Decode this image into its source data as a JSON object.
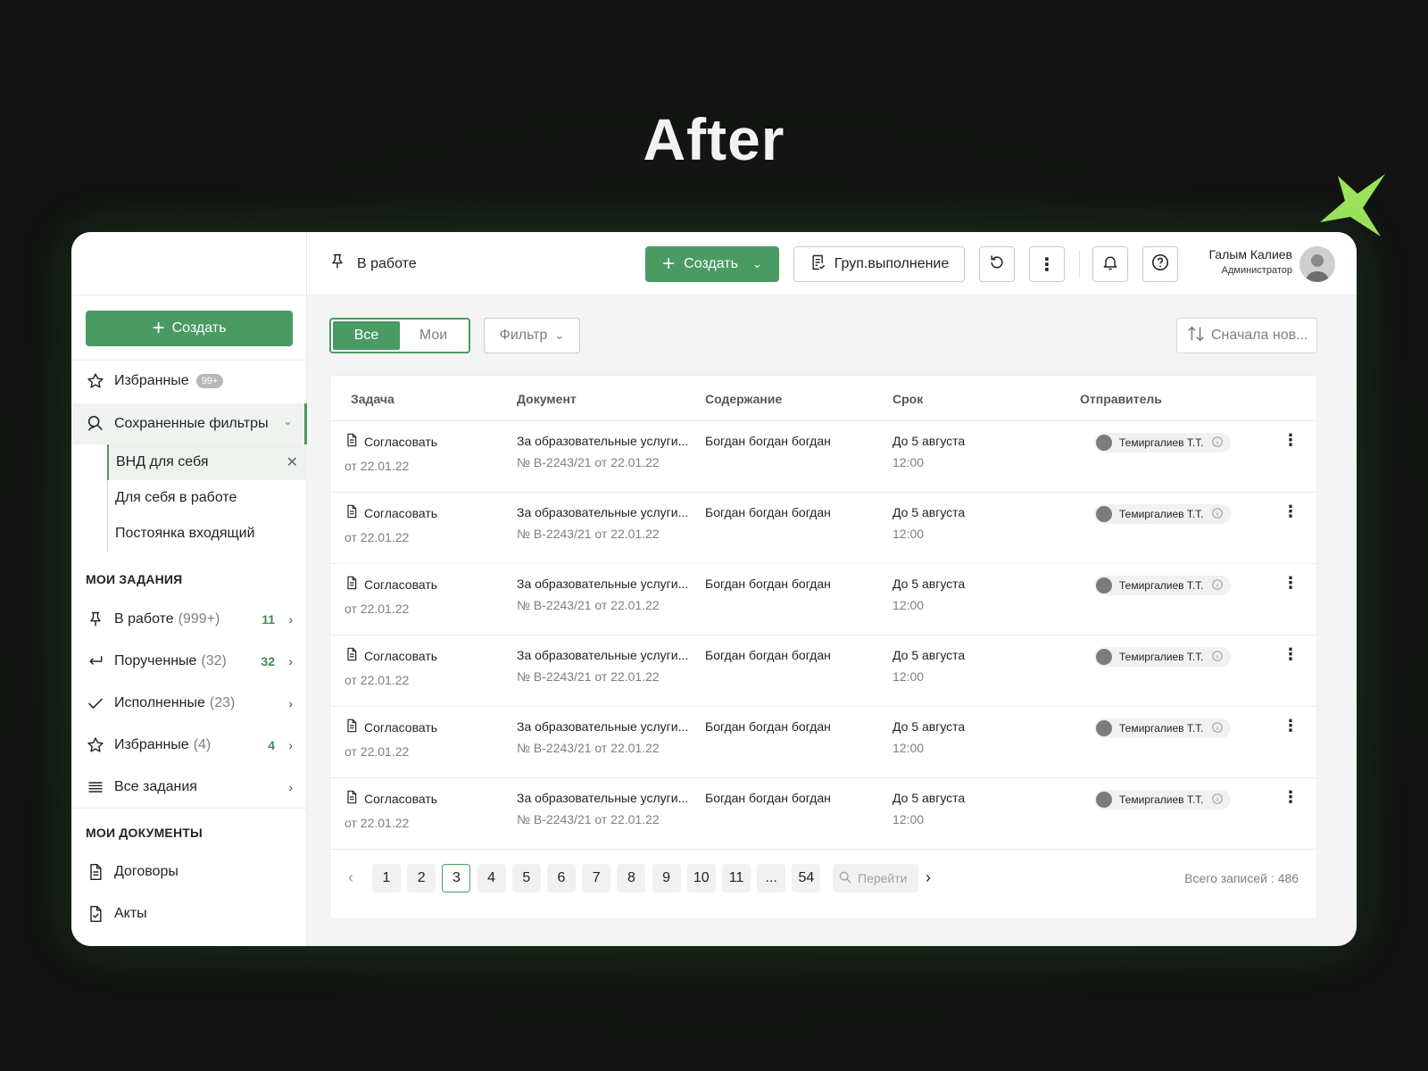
{
  "hero": {
    "title": "After"
  },
  "colors": {
    "accent": "#4a9a64",
    "background": "#121312",
    "sparkle": "#9be35b"
  },
  "sidebar": {
    "create_label": "Создать",
    "favorites": {
      "label": "Избранные",
      "badge": "99+"
    },
    "saved_filters": {
      "label": "Сохраненные фильтры",
      "items": [
        {
          "label": "ВНД для себя"
        },
        {
          "label": "Для себя в работе"
        },
        {
          "label": "Постоянка входящий"
        }
      ]
    },
    "my_tasks": {
      "heading": "МОИ ЗАДАНИЯ",
      "items": [
        {
          "label": "В работе",
          "count": "(999+)",
          "new": "11",
          "icon": "pin-icon"
        },
        {
          "label": "Порученные",
          "count": "(32)",
          "new": "32",
          "icon": "return-arrow-icon"
        },
        {
          "label": "Исполненные",
          "count": "(23)",
          "new": "",
          "icon": "check-icon"
        },
        {
          "label": "Избранные",
          "count": "(4)",
          "new": "4",
          "icon": "star-icon"
        },
        {
          "label": "Все задания",
          "count": "",
          "new": "",
          "icon": "list-icon"
        }
      ]
    },
    "my_documents": {
      "heading": "МОИ ДОКУМЕНТЫ",
      "items": [
        {
          "label": "Договоры",
          "icon": "document-icon"
        },
        {
          "label": "Акты",
          "icon": "document-check-icon"
        }
      ]
    }
  },
  "topbar": {
    "crumb": "В работе",
    "create_label": "Создать",
    "group_label": "Груп.выполнение",
    "user": {
      "name": "Галым Калиев",
      "role": "Администратор"
    }
  },
  "toolbar": {
    "tab_all": "Все",
    "tab_mine": "Мои",
    "filter_label": "Фильтр",
    "sort_label": "Сначала нов..."
  },
  "table": {
    "headers": [
      "Задача",
      "Документ",
      "Содержание",
      "Срок",
      "Отправитель"
    ],
    "rows": [
      {
        "task": "Согласовать",
        "task_date": "от 22.01.22",
        "doc": "За образовательные услуги...",
        "doc_no": "№ B-2243/21 от 22.01.22",
        "content": "Богдан богдан богдан",
        "due": "До 5 августа",
        "due_time": "12:00",
        "sender": "Темиргалиев Т.Т."
      },
      {
        "task": "Согласовать",
        "task_date": "от 22.01.22",
        "doc": "За образовательные услуги...",
        "doc_no": "№ B-2243/21 от 22.01.22",
        "content": "Богдан богдан богдан",
        "due": "До 5 августа",
        "due_time": "12:00",
        "sender": "Темиргалиев Т.Т."
      },
      {
        "task": "Согласовать",
        "task_date": "от 22.01.22",
        "doc": "За образовательные услуги...",
        "doc_no": "№ B-2243/21 от 22.01.22",
        "content": "Богдан богдан богдан",
        "due": "До 5 августа",
        "due_time": "12:00",
        "sender": "Темиргалиев Т.Т."
      },
      {
        "task": "Согласовать",
        "task_date": "от 22.01.22",
        "doc": "За образовательные услуги...",
        "doc_no": "№ B-2243/21 от 22.01.22",
        "content": "Богдан богдан богдан",
        "due": "До 5 августа",
        "due_time": "12:00",
        "sender": "Темиргалиев Т.Т."
      },
      {
        "task": "Согласовать",
        "task_date": "от 22.01.22",
        "doc": "За образовательные услуги...",
        "doc_no": "№ B-2243/21 от 22.01.22",
        "content": "Богдан богдан богдан",
        "due": "До 5 августа",
        "due_time": "12:00",
        "sender": "Темиргалиев Т.Т."
      },
      {
        "task": "Согласовать",
        "task_date": "от 22.01.22",
        "doc": "За образовательные услуги...",
        "doc_no": "№ B-2243/21 от 22.01.22",
        "content": "Богдан богдан богдан",
        "due": "До 5 августа",
        "due_time": "12:00",
        "sender": "Темиргалиев Т.Т."
      }
    ]
  },
  "pagination": {
    "pages": [
      "1",
      "2",
      "3",
      "4",
      "5",
      "6",
      "7",
      "8",
      "9",
      "10",
      "11",
      "...",
      "54"
    ],
    "current": "3",
    "goto_placeholder": "Перейти",
    "total": "Всего записей : 486"
  }
}
